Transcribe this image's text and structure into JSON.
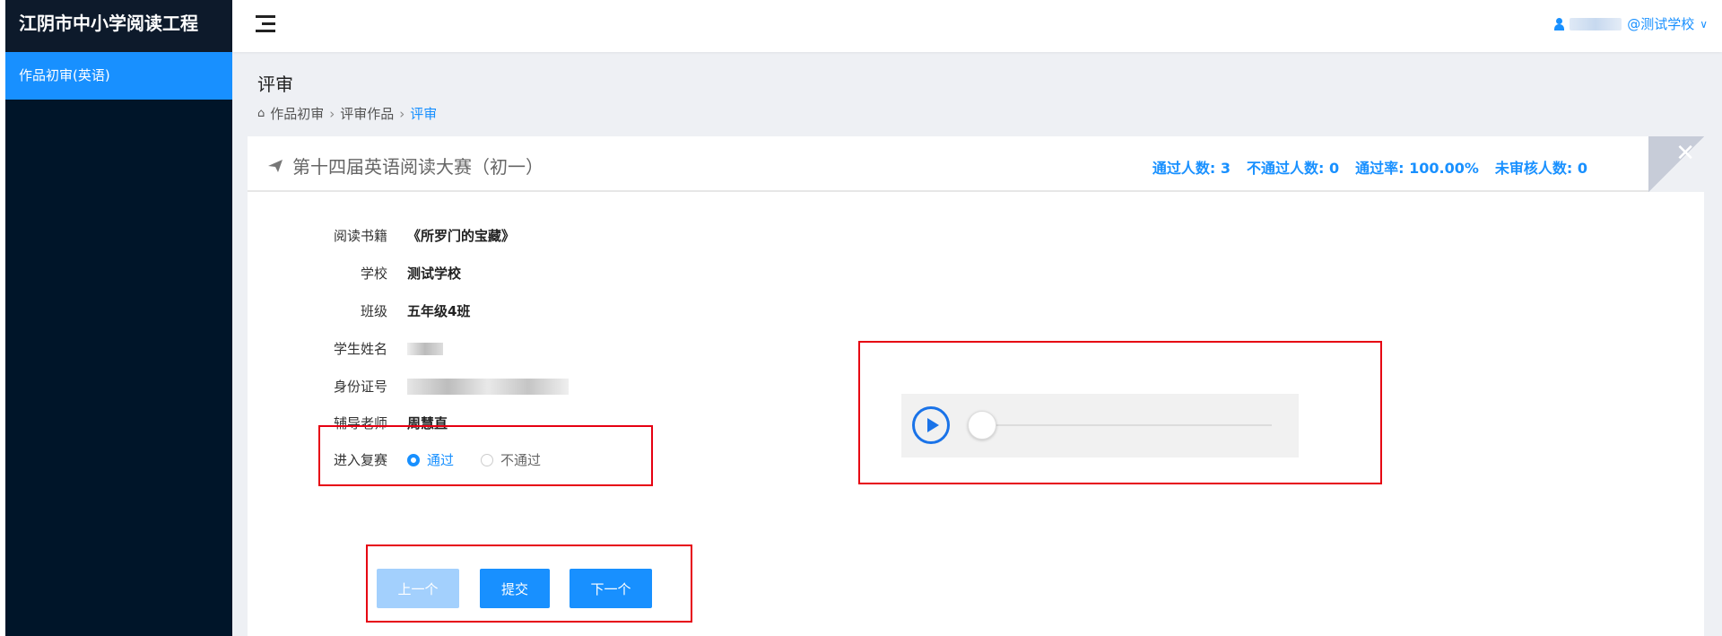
{
  "app": {
    "title": "江阴市中小学阅读工程"
  },
  "sidebar": {
    "items": [
      {
        "label": "作品初审(英语)"
      }
    ]
  },
  "header": {
    "user_label": "@测试学校"
  },
  "page": {
    "title": "评审",
    "breadcrumb": [
      "作品初审",
      "评审作品",
      "评审"
    ]
  },
  "card": {
    "title": "第十四届英语阅读大赛（初一）",
    "stats": {
      "passed": "通过人数: 3",
      "failed": "不通过人数: 0",
      "rate": "通过率: 100.00%",
      "unreviewed": "未审核人数: 0"
    },
    "close_glyph": "✕"
  },
  "form": {
    "book_label": "阅读书籍",
    "book_value": "《所罗门的宝藏》",
    "school_label": "学校",
    "school_value": "测试学校",
    "class_label": "班级",
    "class_value": "五年级4班",
    "student_label": "学生姓名",
    "id_label": "身份证号",
    "teacher_label": "辅导老师",
    "teacher_value": "周慧直",
    "advance_label": "进入复赛",
    "options": [
      {
        "label": "通过",
        "checked": true
      },
      {
        "label": "不通过",
        "checked": false
      }
    ]
  },
  "audio": {
    "progress": 0
  },
  "buttons": {
    "prev": "上一个",
    "submit": "提交",
    "next": "下一个"
  },
  "colors": {
    "sidebar": "#001529",
    "accent": "#1890ff",
    "annotation": "#e60012"
  }
}
